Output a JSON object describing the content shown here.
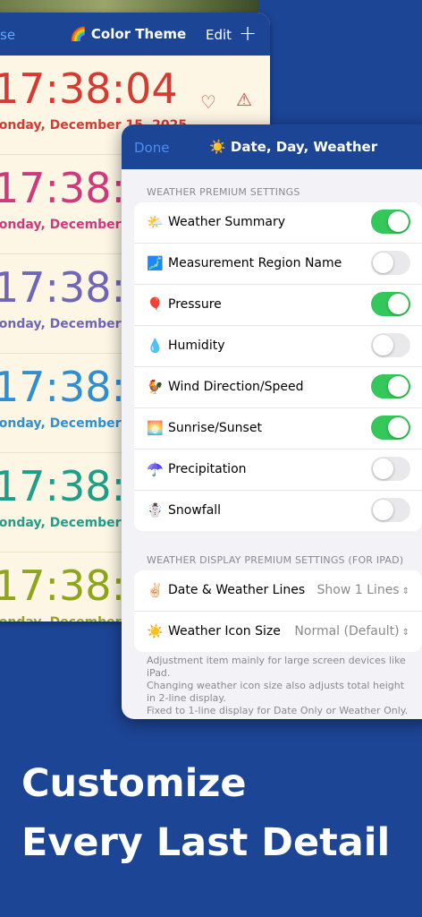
{
  "back_sheet": {
    "nav": {
      "left": "se",
      "title_emoji": "🌈",
      "title": "Color Theme",
      "edit": "Edit",
      "add": "+"
    },
    "clocks": [
      {
        "time": "17:38:04",
        "date": "londay, December 15, 2025",
        "color": "#d63a32"
      },
      {
        "time": "17:38:",
        "date": "londay, December 1",
        "color": "#cf3a7c"
      },
      {
        "time": "17:38:",
        "date": "londay, December 1",
        "color": "#7066b8"
      },
      {
        "time": "17:38:",
        "date": "londay, December 1",
        "color": "#2f8fd3"
      },
      {
        "time": "17:38:",
        "date": "londay, December 1",
        "color": "#1f9e8a"
      },
      {
        "time": "17:38:",
        "date": "londay, December 1",
        "color": "#8ea51c"
      }
    ],
    "icons": {
      "favorite": "heart-icon",
      "warning": "warning-triangle-icon"
    }
  },
  "front_sheet": {
    "nav": {
      "done": "Done",
      "title_emoji": "☀️",
      "title": "Date, Day, Weather"
    },
    "weather_section": {
      "header": "WEATHER PREMIUM SETTINGS",
      "rows": [
        {
          "emoji": "🌤️",
          "label": "Weather Summary",
          "on": true
        },
        {
          "emoji": "🗾",
          "label": "Measurement Region Name",
          "on": false
        },
        {
          "emoji": "🎈",
          "label": "Pressure",
          "on": true
        },
        {
          "emoji": "💧",
          "label": "Humidity",
          "on": false
        },
        {
          "emoji": "🐓",
          "label": "Wind Direction/Speed",
          "on": true
        },
        {
          "emoji": "🌅",
          "label": "Sunrise/Sunset",
          "on": true
        },
        {
          "emoji": "☂️",
          "label": "Precipitation",
          "on": false
        },
        {
          "emoji": "☃️",
          "label": "Snowfall",
          "on": false
        }
      ]
    },
    "display_section": {
      "header": "WEATHER DISPLAY PREMIUM SETTINGS (FOR IPAD)",
      "rows": [
        {
          "emoji": "✌🏻",
          "label": "Date & Weather Lines",
          "value": "Show 1 Lines",
          "chevron": "⌃⌄"
        },
        {
          "emoji": "☀️",
          "label": "Weather Icon Size",
          "value": "Normal (Default)",
          "chevron": "⌃⌄"
        }
      ]
    },
    "footnote": [
      "Adjustment item mainly for large screen devices like iPad.",
      "Changing weather icon size also adjusts total height in 2-line display.",
      "Fixed to 1-line display for Date Only or Weather Only."
    ],
    "colors": {
      "toggle_on": "#34c759",
      "nav_background": "#1c4596",
      "done": "#4d8ef0"
    }
  },
  "headline": {
    "line1": "Customize",
    "line2": "Every Last Detail"
  }
}
